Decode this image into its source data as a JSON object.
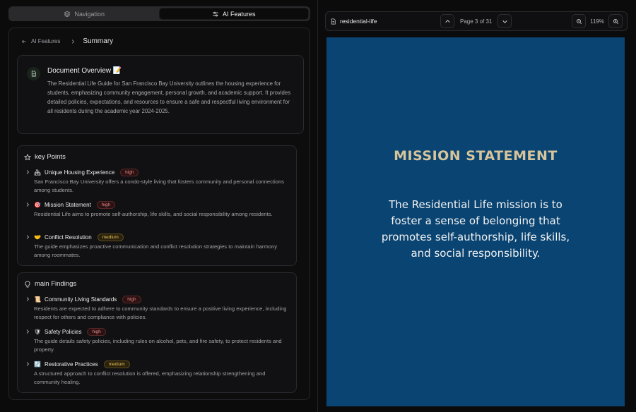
{
  "tabs": [
    {
      "label": "Navigation",
      "icon": "layers-icon",
      "active": false
    },
    {
      "label": "AI Features",
      "icon": "sliders-icon",
      "active": true
    }
  ],
  "breadcrumb": {
    "parent": "AI Features",
    "current": "Summary"
  },
  "overview": {
    "title": "Document Overview 📝",
    "text": "The Residential Life Guide for San Francisco Bay University outlines the housing experience for students, emphasizing community engagement, personal growth, and academic support. It provides detailed policies, expectations, and resources to ensure a safe and respectful living environment for all residents during the academic year 2024-2025."
  },
  "key_points": {
    "title": "key Points",
    "items": [
      {
        "emoji": "🏘",
        "title": "Unique Housing Experience",
        "badge": "high",
        "desc": "San Francisco Bay University offers a condo-style living that fosters community and personal connections among students."
      },
      {
        "emoji": "🎯",
        "title": "Mission Statement",
        "badge": "high",
        "desc": "Residential Life aims to promote self-authorship, life skills, and social responsibility among residents."
      },
      {
        "emoji": "🤝",
        "title": "Conflict Resolution",
        "badge": "medium",
        "desc": "The guide emphasizes proactive communication and conflict resolution strategies to maintain harmony among roommates."
      }
    ]
  },
  "main_findings": {
    "title": "main Findings",
    "items": [
      {
        "emoji": "📜",
        "title": "Community Living Standards",
        "badge": "high",
        "desc": "Residents are expected to adhere to community standards to ensure a positive living experience, including respect for others and compliance with policies."
      },
      {
        "emoji": "🛡",
        "title": "Safety Policies",
        "badge": "high",
        "desc": "The guide details safety policies, including rules on alcohol, pets, and fire safety, to protect residents and property."
      },
      {
        "emoji": "🔄",
        "title": "Restorative Practices",
        "badge": "medium",
        "desc": "A structured approach to conflict resolution is offered, emphasizing relationship strengthening and community healing."
      }
    ]
  },
  "viewer": {
    "file_name": "residential-life",
    "page_label": "Page 3 of 31",
    "zoom": "119%"
  },
  "document": {
    "heading": "MISSION STATEMENT",
    "body": "The Residential Life mission is to foster a sense of belonging that promotes self-authorship, life skills, and social responsibility.",
    "background": "#0a4472",
    "heading_color": "#d8c49a"
  }
}
